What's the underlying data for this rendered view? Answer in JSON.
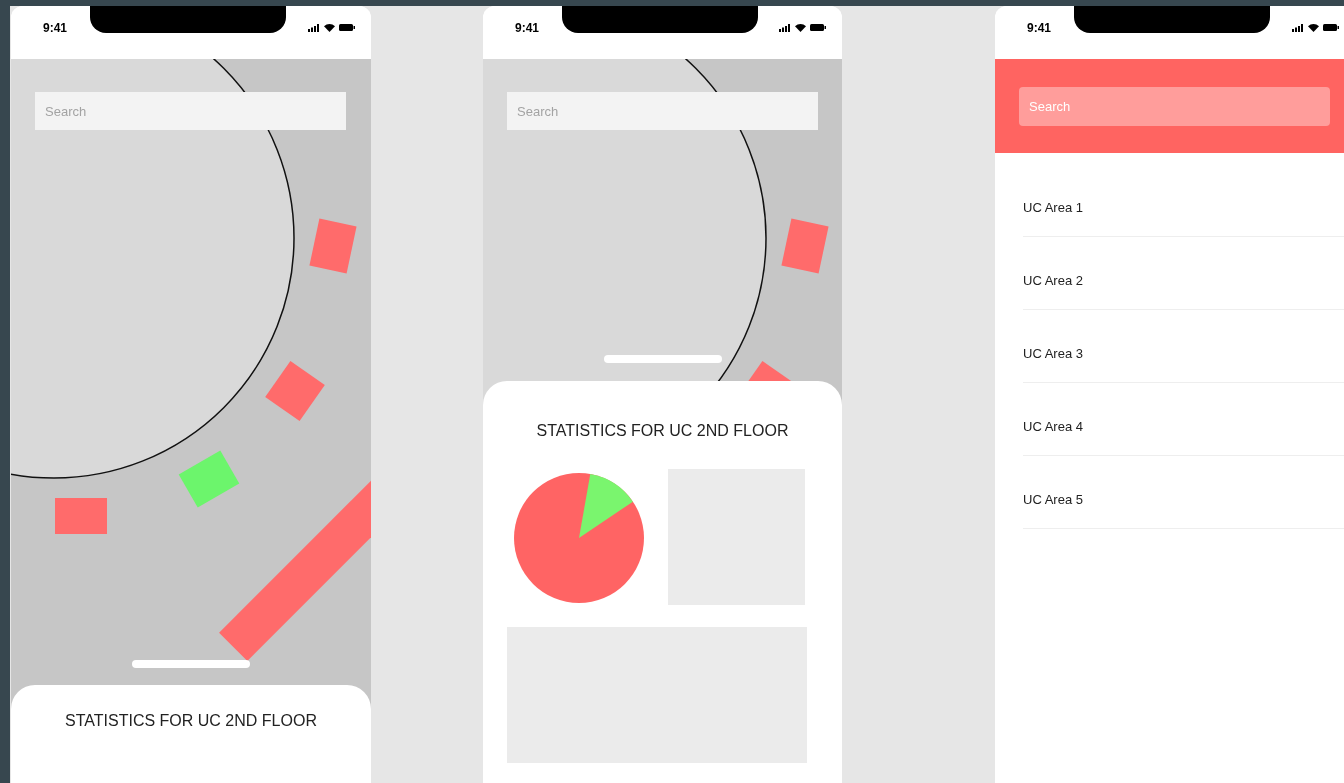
{
  "screens": [
    {
      "kind": "map",
      "status_bar": {
        "time": "9:41"
      },
      "search": {
        "placeholder": "Search"
      },
      "sheet": {
        "title": "STATISTICS FOR UC 2ND FLOOR",
        "expanded": false
      }
    },
    {
      "kind": "map",
      "status_bar": {
        "time": "9:41"
      },
      "search": {
        "placeholder": "Search"
      },
      "sheet": {
        "title": "STATISTICS FOR UC 2ND FLOOR",
        "expanded": true
      }
    },
    {
      "kind": "list",
      "status_bar": {
        "time": "9:41"
      },
      "search": {
        "placeholder": "Search"
      },
      "items": [
        "UC Area 1",
        "UC Area 2",
        "UC Area 3",
        "UC Area 4",
        "UC Area 5"
      ]
    }
  ]
}
